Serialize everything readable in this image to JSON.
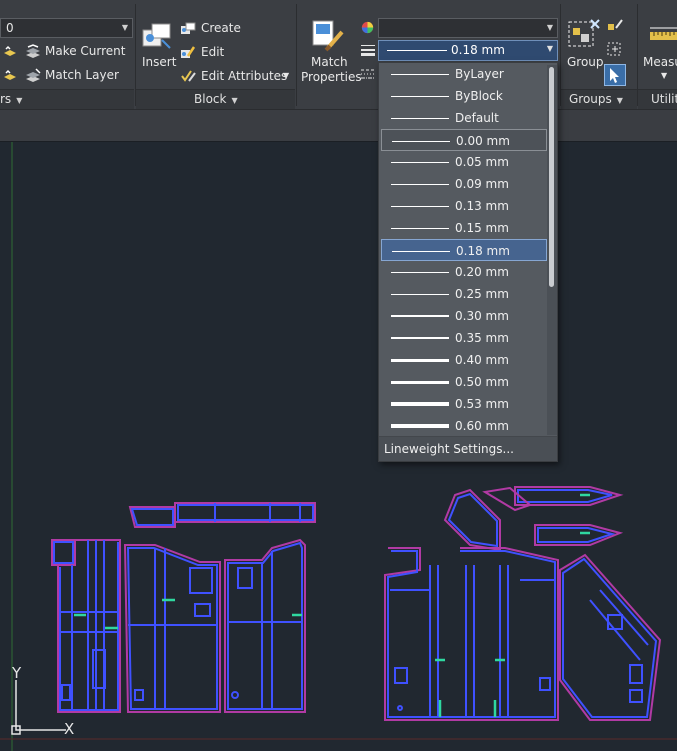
{
  "layers_panel": {
    "current_layer": "0",
    "make_current": "Make Current",
    "match_layer": "Match Layer",
    "title_partial": "rs"
  },
  "block_panel": {
    "insert": "Insert",
    "create": "Create",
    "edit": "Edit",
    "edit_attributes": "Edit Attributes",
    "title": "Block"
  },
  "properties_panel": {
    "match_properties_line1": "Match",
    "match_properties_line2": "Properties",
    "lineweight_selected": "0.18 mm"
  },
  "groups_panel": {
    "group": "Group",
    "title": "Groups"
  },
  "utilities_panel": {
    "measure": "Measu",
    "title": "Utilit"
  },
  "lineweight_list": {
    "items": [
      {
        "label": "ByLayer",
        "state": "normal"
      },
      {
        "label": "ByBlock",
        "state": "normal"
      },
      {
        "label": "Default",
        "state": "normal"
      },
      {
        "label": "0.00 mm",
        "state": "current"
      },
      {
        "label": "0.05 mm",
        "state": "normal"
      },
      {
        "label": "0.09 mm",
        "state": "normal"
      },
      {
        "label": "0.13 mm",
        "state": "normal"
      },
      {
        "label": "0.15 mm",
        "state": "normal"
      },
      {
        "label": "0.18 mm",
        "state": "selected"
      },
      {
        "label": "0.20 mm",
        "state": "normal"
      },
      {
        "label": "0.25 mm",
        "state": "normal"
      },
      {
        "label": "0.30 mm",
        "state": "normal"
      },
      {
        "label": "0.35 mm",
        "state": "normal"
      },
      {
        "label": "0.40 mm",
        "state": "normal"
      },
      {
        "label": "0.50 mm",
        "state": "normal"
      },
      {
        "label": "0.53 mm",
        "state": "normal"
      },
      {
        "label": "0.60 mm",
        "state": "normal"
      }
    ],
    "settings": "Lineweight Settings..."
  },
  "ucs": {
    "x_label": "X",
    "y_label": "Y"
  },
  "colors": {
    "drawing_blue": "#3f51ff",
    "drawing_magenta": "#b13aa4",
    "drawing_green": "#2fd8a0",
    "canvas": "#212830",
    "selection": "#46648f"
  }
}
